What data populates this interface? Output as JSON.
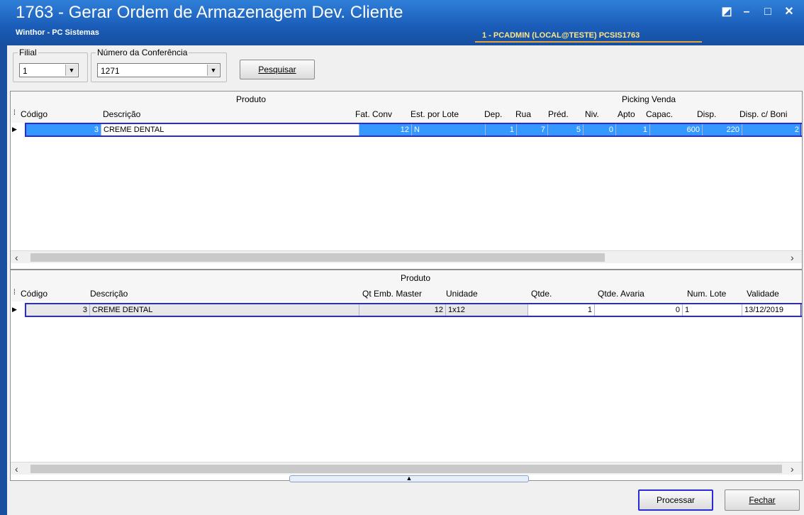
{
  "window": {
    "title": "1763 - Gerar Ordem de Armazenagem Dev. Cliente",
    "subtitle": "Winthor - PC Sistemas",
    "user_info": "1 - PCADMIN (LOCAL@TESTE)  PCSIS1763",
    "restore_glyph": "◩",
    "minimize_glyph": "–",
    "maximize_glyph": "□",
    "close_glyph": "✕"
  },
  "filters": {
    "filial_label": "Filial",
    "filial_value": "1",
    "conferencia_label": "Número da Conferência",
    "conferencia_value": "1271",
    "search_button": "Pesquisar"
  },
  "grid1": {
    "group_produto": "Produto",
    "group_picking": "Picking Venda",
    "columns": [
      "Código",
      "Descrição",
      "Fat. Conv",
      "Est. por Lote",
      "Dep.",
      "Rua",
      "Préd.",
      "Niv.",
      "Apto",
      "Capac.",
      "Disp.",
      "Disp. c/ Boni"
    ],
    "rows": [
      {
        "codigo": "3",
        "descricao": "CREME DENTAL",
        "fat_conv": "12",
        "est_lote": "N",
        "dep": "1",
        "rua": "7",
        "pred": "5",
        "niv": "0",
        "apto": "1",
        "capac": "600",
        "disp": "220",
        "disp_boni": "2"
      }
    ]
  },
  "grid2": {
    "group_produto": "Produto",
    "columns": [
      "Código",
      "Descrição",
      "Qt Emb. Master",
      "Unidade",
      "Qtde.",
      "Qtde. Avaria",
      "Num. Lote",
      "Validade"
    ],
    "rows": [
      {
        "codigo": "3",
        "descricao": "CREME DENTAL",
        "qt_emb": "12",
        "unidade": "1x12",
        "qtde": "1",
        "avaria": "0",
        "lote": "1",
        "validade": "13/12/2019"
      }
    ]
  },
  "footer": {
    "process_button": "Processar",
    "close_button": "Fechar"
  },
  "colors": {
    "accent": "#1a4fa0",
    "selection": "#3399ff"
  }
}
